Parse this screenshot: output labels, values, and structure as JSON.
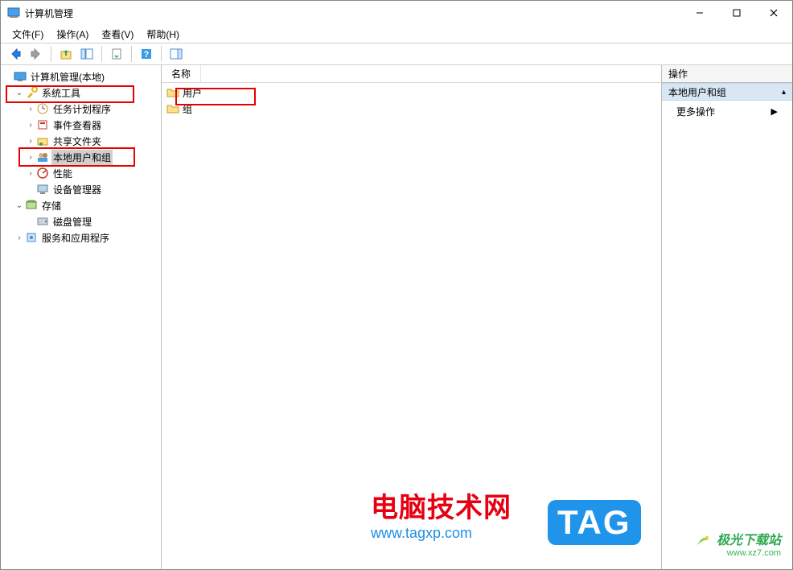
{
  "window": {
    "title": "计算机管理"
  },
  "window_controls": {
    "min": "—",
    "max": "□",
    "close": "✕"
  },
  "menu": {
    "file": "文件(F)",
    "action": "操作(A)",
    "view": "查看(V)",
    "help": "帮助(H)"
  },
  "tree": {
    "root": "计算机管理(本地)",
    "system_tools": "系统工具",
    "task_scheduler": "任务计划程序",
    "event_viewer": "事件查看器",
    "shared_folders": "共享文件夹",
    "local_users": "本地用户和组",
    "performance": "性能",
    "device_manager": "设备管理器",
    "storage": "存储",
    "disk_mgmt": "磁盘管理",
    "services_apps": "服务和应用程序"
  },
  "list": {
    "col_name": "名称",
    "items": [
      {
        "label": "用户"
      },
      {
        "label": "组"
      }
    ]
  },
  "actions": {
    "header": "操作",
    "group": "本地用户和组",
    "more": "更多操作"
  },
  "watermark": {
    "site1_title": "电脑技术网",
    "site1_url": "www.tagxp.com",
    "tag_text": "TAG",
    "site2_title": "极光下载站",
    "site2_url": "www.xz7.com"
  }
}
